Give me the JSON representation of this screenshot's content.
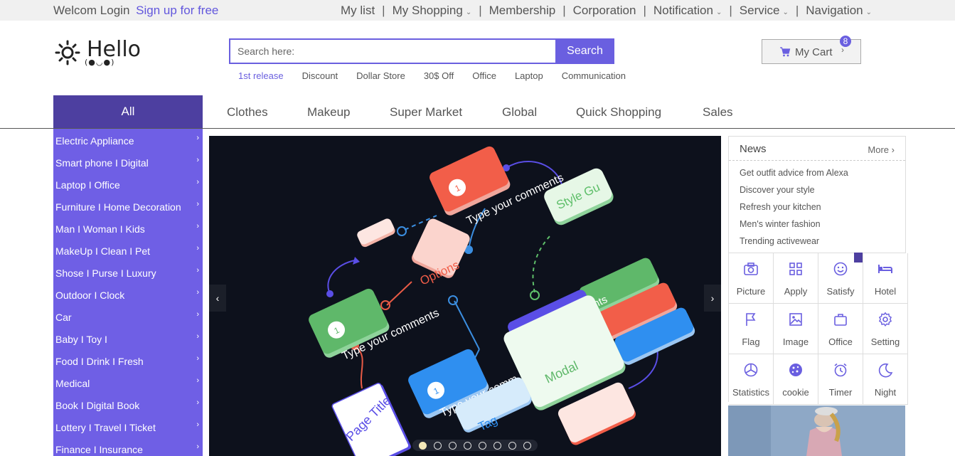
{
  "topbar": {
    "welcome": "Welcom Login",
    "signup": "Sign up for free",
    "nav": [
      {
        "label": "My list",
        "caret": false
      },
      {
        "label": "My Shopping",
        "caret": true
      },
      {
        "label": "Membership",
        "caret": false
      },
      {
        "label": "Corporation",
        "caret": false
      },
      {
        "label": "Notification",
        "caret": true
      },
      {
        "label": "Service",
        "caret": true
      },
      {
        "label": "Navigation",
        "caret": true
      }
    ]
  },
  "logo": {
    "text": "Hello",
    "sub": "(●◡●)"
  },
  "search": {
    "placeholder": "Search here:",
    "button": "Search",
    "hot": [
      "1st release",
      "Discount",
      "Dollar Store",
      "30$ Off",
      "Office",
      "Laptop",
      "Communication"
    ]
  },
  "cart": {
    "label": "My Cart",
    "count": "8",
    "icon": "cart-icon"
  },
  "categories": {
    "all": "All",
    "tabs": [
      "Clothes",
      "Makeup",
      "Super Market",
      "Global",
      "Quick Shopping",
      "Sales"
    ]
  },
  "sidebar": {
    "items": [
      "Electric Appliance",
      "Smart phone I  Digital",
      "Laptop I  Office",
      "Furniture I  Home Decoration",
      "Man I  Woman I  Kids",
      "MakeUp I  Clean I  Pet",
      "Shose I  Purse I  Luxury",
      "Outdoor I  Clock",
      "Car",
      "Baby I  Toy I",
      "Food I  Drink I  Fresh",
      "Medical",
      "Book I  Digital Book",
      "Lottery I  Travel I  Ticket",
      "Finance I  Insurance"
    ]
  },
  "banner": {
    "texts": {
      "comment1": "Type your comments",
      "comment2": "Type your comments",
      "comment3": "Type your comments",
      "comment4": "Type your comm",
      "style": "Style Gu",
      "options": "Options",
      "modal": "Modal",
      "tag": "Tag",
      "page_title": "Page Title",
      "badge": "1"
    },
    "slides": 8,
    "active_slide": 1
  },
  "news": {
    "title": "News",
    "more": "More",
    "items": [
      "Get outfit advice from Alexa",
      "Discover your style",
      "Refresh your kitchen",
      "Men's winter fashion",
      "Trending activewear"
    ]
  },
  "services": [
    {
      "label": "Picture",
      "icon": "camera-icon"
    },
    {
      "label": "Apply",
      "icon": "grid-icon"
    },
    {
      "label": "Satisfy",
      "icon": "smile-icon"
    },
    {
      "label": "Hotel",
      "icon": "bed-icon"
    },
    {
      "label": "Flag",
      "icon": "flag-icon"
    },
    {
      "label": "Image",
      "icon": "image-icon"
    },
    {
      "label": "Office",
      "icon": "briefcase-icon"
    },
    {
      "label": "Setting",
      "icon": "gear-icon"
    },
    {
      "label": "Statistics",
      "icon": "pie-chart-icon"
    },
    {
      "label": "cookie",
      "icon": "cookie-icon"
    },
    {
      "label": "Timer",
      "icon": "alarm-clock-icon"
    },
    {
      "label": "Night",
      "icon": "moon-icon"
    }
  ],
  "colors": {
    "accent": "#6a5fe0",
    "sidebar": "#6f5fe5",
    "all_tab": "#4d3fa0"
  }
}
